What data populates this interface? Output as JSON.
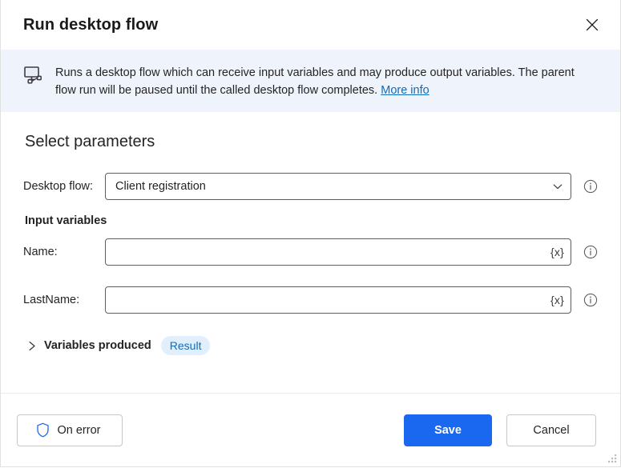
{
  "dialog": {
    "title": "Run desktop flow",
    "close_label": "Close"
  },
  "banner": {
    "icon": "desktop-flow-icon",
    "text": "Runs a desktop flow which can receive input variables and may produce output variables. The parent flow run will be paused until the called desktop flow completes.",
    "link_label": "More info"
  },
  "main": {
    "section_title": "Select parameters",
    "desktop_flow": {
      "label": "Desktop flow:",
      "value": "Client registration",
      "placeholder": "",
      "chevron_icon": "chevron-down-icon",
      "info_icon": "info-circle-icon"
    },
    "input_variables": {
      "title": "Input variables",
      "fields": [
        {
          "label": "Name:",
          "value": "",
          "placeholder": "",
          "variable_button": "{x}",
          "info_icon": "info-circle-icon"
        },
        {
          "label": "LastName:",
          "value": "",
          "placeholder": "",
          "variable_button": "{x}",
          "info_icon": "info-circle-icon"
        }
      ]
    },
    "variables_produced": {
      "chevron_icon": "chevron-right-icon",
      "label": "Variables produced",
      "badge": "Result"
    }
  },
  "footer": {
    "on_error": {
      "label": "On error",
      "icon": "shield-icon"
    },
    "save_label": "Save",
    "cancel_label": "Cancel"
  },
  "colors": {
    "accent": "#1a68f0",
    "link": "#0f6cbd",
    "banner_bg": "#eff4fc",
    "badge_bg": "#e1effc",
    "badge_text": "#0f6cbd",
    "field_border": "#605e5c",
    "text": "#242424"
  }
}
